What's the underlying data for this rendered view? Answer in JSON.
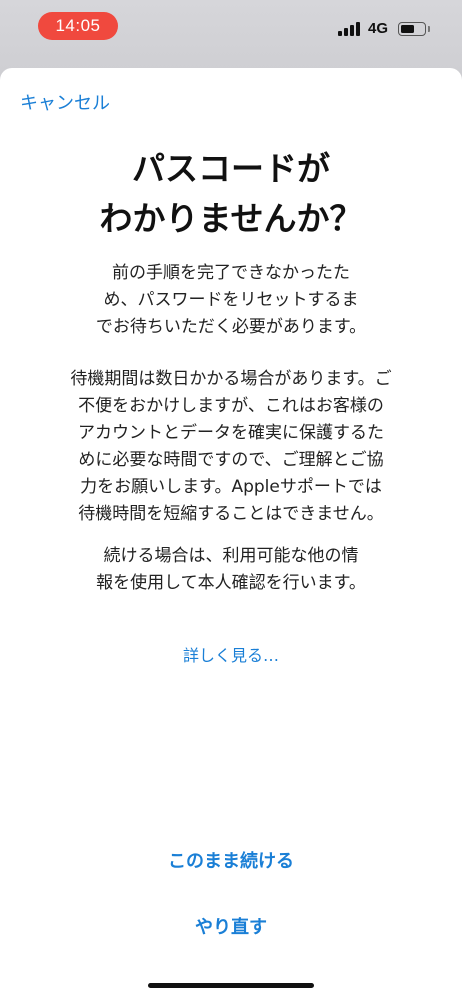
{
  "status_bar": {
    "time": "14:05",
    "network": "4G",
    "battery_level": 0.6
  },
  "sheet": {
    "cancel_label": "キャンセル",
    "title_lines": [
      "パスコードが",
      "わかりませんか？"
    ],
    "paragraph1_lines": [
      "前の手順を完了できなかったた",
      "め、パスワードをリセットするま",
      "でお待ちいただく必要があります。"
    ],
    "paragraph2_lines": [
      "待機期間は数日かかる場合があります。ご",
      "不便をおかけしますが、これはお客様の",
      "アカウントとデータを確実に保護するた",
      "めに必要な時間ですので、ご理解とご協",
      "力をお願いします。Appleサポートでは",
      "待機時間を短縮することはできません。"
    ],
    "paragraph3_lines": [
      "続ける場合は、利用可能な他の情",
      "報を使用して本人確認を行います。"
    ],
    "learn_more": "詳しく見る…",
    "continue_button": "このまま続ける",
    "retry_button": "やり直す"
  },
  "colors": {
    "accent": "#1a7fd6",
    "time_pill": "#f0493e"
  }
}
